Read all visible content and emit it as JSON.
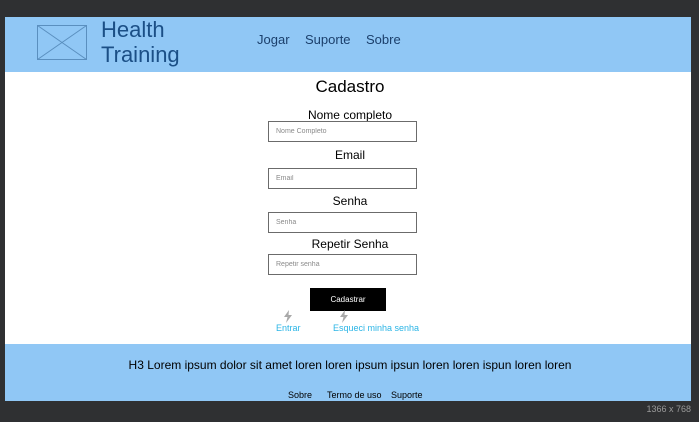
{
  "header": {
    "brand_line1": "Health",
    "brand_line2": "Training",
    "nav": [
      "Jogar",
      "Suporte",
      "Sobre"
    ]
  },
  "form": {
    "title": "Cadastro",
    "fields": [
      {
        "label": "Nome completo",
        "placeholder": "Nome Completo"
      },
      {
        "label": "Email",
        "placeholder": "Email"
      },
      {
        "label": "Senha",
        "placeholder": "Senha"
      },
      {
        "label": "Repetir Senha",
        "placeholder": "Repetir senha"
      }
    ],
    "submit_label": "Cadastrar",
    "links": [
      {
        "label": "Entrar",
        "icon": "lightning-icon"
      },
      {
        "label": "Esqueci minha senha",
        "icon": "lightning-icon"
      }
    ]
  },
  "footer": {
    "text": "H3 Lorem ipsum dolor sit amet loren loren ipsum ipsun loren loren ispun loren loren",
    "links": [
      "Sobre",
      "Termo de uso",
      "Suporte"
    ]
  },
  "resolution_label": "1366 x 768",
  "colors": {
    "header_bg": "#90c7f5",
    "footer_bg": "#90c7f5",
    "link": "#2bb5e6",
    "brand": "#1b4f86",
    "frame": "#2f3032"
  }
}
